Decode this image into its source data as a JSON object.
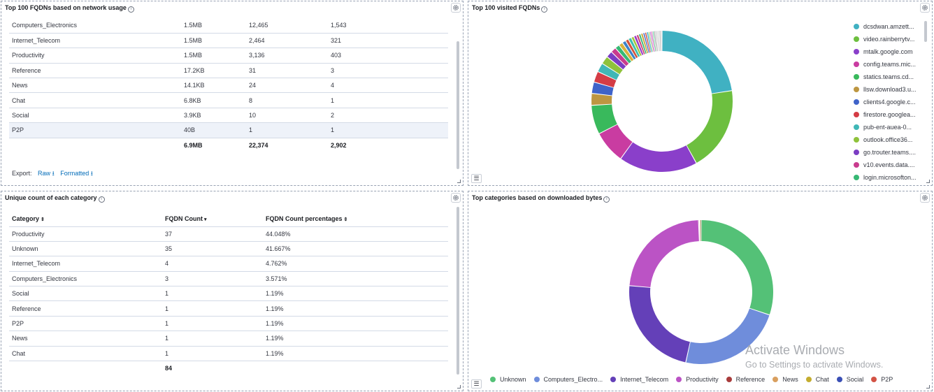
{
  "panel_network": {
    "title": "Top 100 FQDNs based on network usage",
    "rows": [
      [
        "Computers_Electronics",
        "1.5MB",
        "12,465",
        "1,543"
      ],
      [
        "Internet_Telecom",
        "1.5MB",
        "2,464",
        "321"
      ],
      [
        "Productivity",
        "1.5MB",
        "3,136",
        "403"
      ],
      [
        "Reference",
        "17.2KB",
        "31",
        "3"
      ],
      [
        "News",
        "14.1KB",
        "24",
        "4"
      ],
      [
        "Chat",
        "6.8KB",
        "8",
        "1"
      ],
      [
        "Social",
        "3.9KB",
        "10",
        "2"
      ],
      [
        "P2P",
        "40B",
        "1",
        "1"
      ]
    ],
    "totals": [
      "",
      "6.9MB",
      "22,374",
      "2,902"
    ],
    "export_label": "Export:",
    "export_raw": "Raw",
    "export_formatted": "Formatted"
  },
  "panel_visited": {
    "title": "Top 100 visited FQDNs",
    "legend": [
      {
        "label": "dcsdwan.amzett...",
        "color": "#40b1c2"
      },
      {
        "label": "video.rainberrytv...",
        "color": "#6dbf3f"
      },
      {
        "label": "mtalk.google.com",
        "color": "#8a3fca"
      },
      {
        "label": "config.teams.mic...",
        "color": "#c93ca1"
      },
      {
        "label": "statics.teams.cd...",
        "color": "#39b95c"
      },
      {
        "label": "llsw.download3.u...",
        "color": "#bd9641"
      },
      {
        "label": "clients4.google.c...",
        "color": "#3f63c9"
      },
      {
        "label": "firestore.googlea...",
        "color": "#d43c45"
      },
      {
        "label": "pub-ent-auea-0...",
        "color": "#40b7b6"
      },
      {
        "label": "outlook.office36...",
        "color": "#8fc23b"
      },
      {
        "label": "go.trouter.teams....",
        "color": "#7b3dc3"
      },
      {
        "label": "v10.events.data....",
        "color": "#c93c8e"
      },
      {
        "label": "login.microsofton...",
        "color": "#37b874"
      }
    ]
  },
  "panel_unique": {
    "title": "Unique count of each category",
    "headers": [
      "Category",
      "FQDN Count",
      "FQDN Count percentages"
    ],
    "rows": [
      [
        "Productivity",
        "37",
        "44.048%"
      ],
      [
        "Unknown",
        "35",
        "41.667%"
      ],
      [
        "Internet_Telecom",
        "4",
        "4.762%"
      ],
      [
        "Computers_Electronics",
        "3",
        "3.571%"
      ],
      [
        "Social",
        "1",
        "1.19%"
      ],
      [
        "Reference",
        "1",
        "1.19%"
      ],
      [
        "P2P",
        "1",
        "1.19%"
      ],
      [
        "News",
        "1",
        "1.19%"
      ],
      [
        "Chat",
        "1",
        "1.19%"
      ]
    ],
    "total": "84"
  },
  "panel_downloaded": {
    "title": "Top categories based on downloaded bytes",
    "legend": [
      {
        "label": "Unknown",
        "color": "#54c177"
      },
      {
        "label": "Computers_Electro...",
        "color": "#6f8ddb"
      },
      {
        "label": "Internet_Telecom",
        "color": "#6440b8"
      },
      {
        "label": "Productivity",
        "color": "#bb53c5"
      },
      {
        "label": "Reference",
        "color": "#a83b3b"
      },
      {
        "label": "News",
        "color": "#d99f5f"
      },
      {
        "label": "Chat",
        "color": "#c4ad2f"
      },
      {
        "label": "Social",
        "color": "#3a4fb5"
      },
      {
        "label": "P2P",
        "color": "#d35345"
      }
    ]
  },
  "chart_data": [
    {
      "type": "pie",
      "title": "Top 100 visited FQDNs",
      "donut": true,
      "slices": [
        {
          "label": "dcsdwan.amzett...",
          "value": 21.7,
          "color": "#40b1c2"
        },
        {
          "label": "video.rainberrytv...",
          "value": 18.6,
          "color": "#6dbf3f"
        },
        {
          "label": "mtalk.google.com",
          "value": 17.3,
          "color": "#8a3fca"
        },
        {
          "label": "config.teams.mic...",
          "value": 7.2,
          "color": "#c93ca1"
        },
        {
          "label": "statics.teams.cd...",
          "value": 6.4,
          "color": "#39b95c"
        },
        {
          "label": "llsw.download3.u...",
          "value": 2.6,
          "color": "#bd9641"
        },
        {
          "label": "clients4.google.c...",
          "value": 2.5,
          "color": "#3f63c9"
        },
        {
          "label": "firestore.googlea...",
          "value": 2.4,
          "color": "#d43c45"
        },
        {
          "label": "pub-ent-auea-0...",
          "value": 2.0,
          "color": "#40b7b6"
        },
        {
          "label": "outlook.office36...",
          "value": 1.8,
          "color": "#8fc23b"
        },
        {
          "label": "go.trouter.teams....",
          "value": 1.4,
          "color": "#7b3dc3"
        },
        {
          "label": "v10.events.data....",
          "value": 1.2,
          "color": "#c93c8e"
        },
        {
          "label": "login.microsofton...",
          "value": 1.0,
          "color": "#37b874"
        },
        {
          "label": "",
          "value": 0.9,
          "color": "#d9b23c"
        },
        {
          "label": "",
          "value": 0.8,
          "color": "#3c82c9"
        },
        {
          "label": "",
          "value": 0.7,
          "color": "#d3543c"
        },
        {
          "label": "",
          "value": 0.7,
          "color": "#3cc0b0"
        },
        {
          "label": "",
          "value": 0.6,
          "color": "#a3c43c"
        },
        {
          "label": "",
          "value": 0.6,
          "color": "#9a3cc9"
        },
        {
          "label": "",
          "value": 0.5,
          "color": "#c93c6b"
        },
        {
          "label": "",
          "value": 0.5,
          "color": "#3cb97a"
        },
        {
          "label": "",
          "value": 0.5,
          "color": "#c9a83c"
        },
        {
          "label": "",
          "value": 0.4,
          "color": "#3c5cc9"
        },
        {
          "label": "",
          "value": 0.4,
          "color": "#c94a3c"
        },
        {
          "label": "",
          "value": 0.4,
          "color": "#3cb0c9"
        },
        {
          "label": "",
          "value": 0.3,
          "color": "#7cc93c"
        },
        {
          "label": "",
          "value": 0.3,
          "color": "#b13cc9"
        },
        {
          "label": "",
          "value": 0.3,
          "color": "#c93c9a"
        },
        {
          "label": "",
          "value": 0.3,
          "color": "#3cc985"
        },
        {
          "label": "",
          "value": 0.3,
          "color": "#888888"
        },
        {
          "label": "",
          "value": 0.3,
          "color": "#aaaaaa"
        },
        {
          "label": "",
          "value": 0.3,
          "color": "#c9c9c9"
        },
        {
          "label": "",
          "value": 0.3,
          "color": "#bcbcbc"
        },
        {
          "label": "",
          "value": 0.3,
          "color": "#a0a0a0"
        },
        {
          "label": "",
          "value": 0.3,
          "color": "#d0d0d0"
        }
      ]
    },
    {
      "type": "pie",
      "title": "Top categories based on downloaded bytes",
      "donut": true,
      "slices": [
        {
          "label": "Unknown",
          "value": 28.2,
          "color": "#54c177"
        },
        {
          "label": "Computers_Electro...",
          "value": 21.8,
          "color": "#6f8ddb"
        },
        {
          "label": "Internet_Telecom",
          "value": 21.5,
          "color": "#6440b8"
        },
        {
          "label": "Productivity",
          "value": 21.5,
          "color": "#bb53c5"
        },
        {
          "label": "Reference",
          "value": 0.2,
          "color": "#a83b3b"
        },
        {
          "label": "News",
          "value": 0.2,
          "color": "#d99f5f"
        },
        {
          "label": "Chat",
          "value": 0.1,
          "color": "#c4ad2f"
        },
        {
          "label": "Social",
          "value": 0.05,
          "color": "#3a4fb5"
        },
        {
          "label": "P2P",
          "value": 0.01,
          "color": "#d35345"
        }
      ]
    }
  ],
  "watermark": {
    "line1": "Activate Windows",
    "line2": "Go to Settings to activate Windows."
  }
}
